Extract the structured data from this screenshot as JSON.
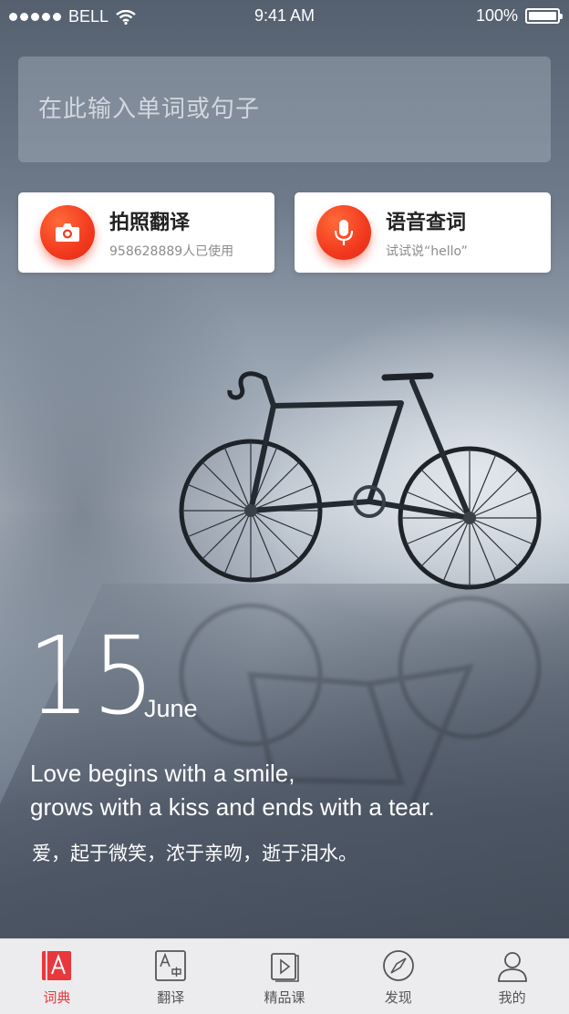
{
  "status_bar": {
    "carrier": "BELL",
    "time": "9:41 AM",
    "battery": "100%"
  },
  "search": {
    "placeholder": "在此输入单词或句子"
  },
  "actions": [
    {
      "title": "拍照翻译",
      "subtitle": "958628889人已使用",
      "icon": "camera-icon"
    },
    {
      "title": "语音查词",
      "subtitle": "试试说“hello”",
      "icon": "microphone-icon"
    }
  ],
  "daily": {
    "day": "15",
    "month": "June",
    "quote_en_line1": "Love begins with a smile,",
    "quote_en_line2": "grows with a kiss and ends with a tear.",
    "quote_zh": "爱，起于微笑，浓于亲吻，逝于泪水。"
  },
  "tabs": [
    {
      "label": "词典",
      "icon": "dictionary-icon",
      "active": true
    },
    {
      "label": "翻译",
      "icon": "translate-icon",
      "active": false
    },
    {
      "label": "精品课",
      "icon": "course-icon",
      "active": false
    },
    {
      "label": "发现",
      "icon": "compass-icon",
      "active": false
    },
    {
      "label": "我的",
      "icon": "profile-icon",
      "active": false
    }
  ],
  "colors": {
    "accent": "#e8383d",
    "action_button": "#f23a1e",
    "tabbar_bg": "#ececee"
  }
}
